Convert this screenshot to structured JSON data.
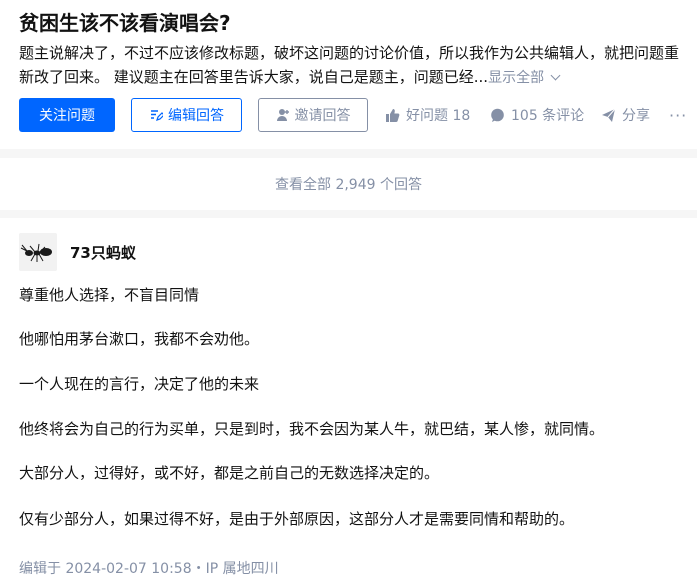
{
  "question": {
    "title": "贫困生该不该看演唱会?",
    "description": "题主说解决了，不过不应该修改标题，破坏这问题的讨论价值，所以我作为公共编辑人，就把问题重新改了回来。 建议题主在回答里告诉大家，说自己是题主，问题已经...",
    "show_all": "显示全部"
  },
  "actions": {
    "follow": "关注问题",
    "edit_answer": "编辑回答",
    "invite": "邀请回答",
    "good_question": "好问题 18",
    "comments": "105 条评论",
    "share": "分享",
    "more": "···"
  },
  "view_all": "查看全部 2,949 个回答",
  "answer": {
    "author": "73只蚂蚁",
    "paragraphs": [
      "尊重他人选择，不盲目同情",
      "他哪怕用茅台漱口，我都不会劝他。",
      "一个人现在的言行，决定了他的未来",
      "他终将会为自己的行为买单，只是到时，我不会因为某人牛，就巴结，某人惨，就同情。",
      "大部分人，过得好，或不好，都是之前自己的无数选择决定的。",
      "仅有少部分人，如果过得不好，是由于外部原因，这部分人才是需要同情和帮助的。"
    ],
    "edited": "编辑于 2024-02-07 10:58・IP 属地四川"
  },
  "colors": {
    "accent": "#0066ff",
    "muted": "#8590a6",
    "text": "#121212"
  }
}
